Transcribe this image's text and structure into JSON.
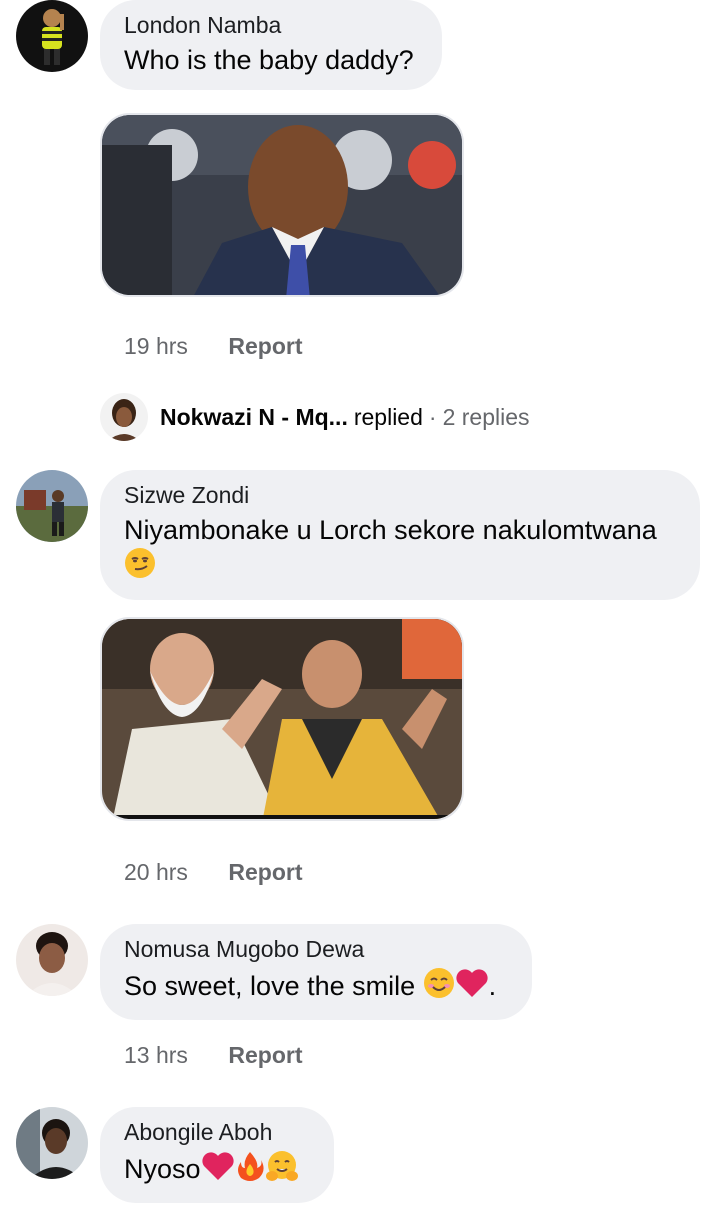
{
  "comments": [
    {
      "author": "London Namba",
      "text": "Who is the baby daddy?",
      "time": "19 hrs",
      "report_label": "Report",
      "avatar": "cartoon-avatar",
      "attachment": "photo-man-in-suit"
    },
    {
      "author": "Sizwe Zondi",
      "text": "Niyambonake u Lorch sekore nakulomtwana",
      "emoji": [
        "smirking-face-emoji"
      ],
      "time": "20 hrs",
      "report_label": "Report",
      "avatar": "outdoor-avatar",
      "attachment": "photo-two-men-clapping"
    },
    {
      "author": "Nomusa Mugobo Dewa",
      "text": "So sweet, love the smile ",
      "text_suffix": ".",
      "emoji": [
        "smiling-face-emoji",
        "red-heart-emoji"
      ],
      "time": "13 hrs",
      "report_label": "Report",
      "avatar": "woman-avatar"
    },
    {
      "author": "Abongile Aboh",
      "text": "Nyoso",
      "emoji": [
        "red-heart-emoji",
        "fire-emoji",
        "hugging-face-emoji"
      ],
      "avatar": "man-avatar"
    }
  ],
  "replies_row": {
    "name": "Nokwazi N - Mq...",
    "verb": "replied",
    "separator": "·",
    "count_label": "2 replies"
  },
  "colors": {
    "bubble": "#eff0f3",
    "meta_text": "#65676b",
    "heart": "#e0245e"
  }
}
